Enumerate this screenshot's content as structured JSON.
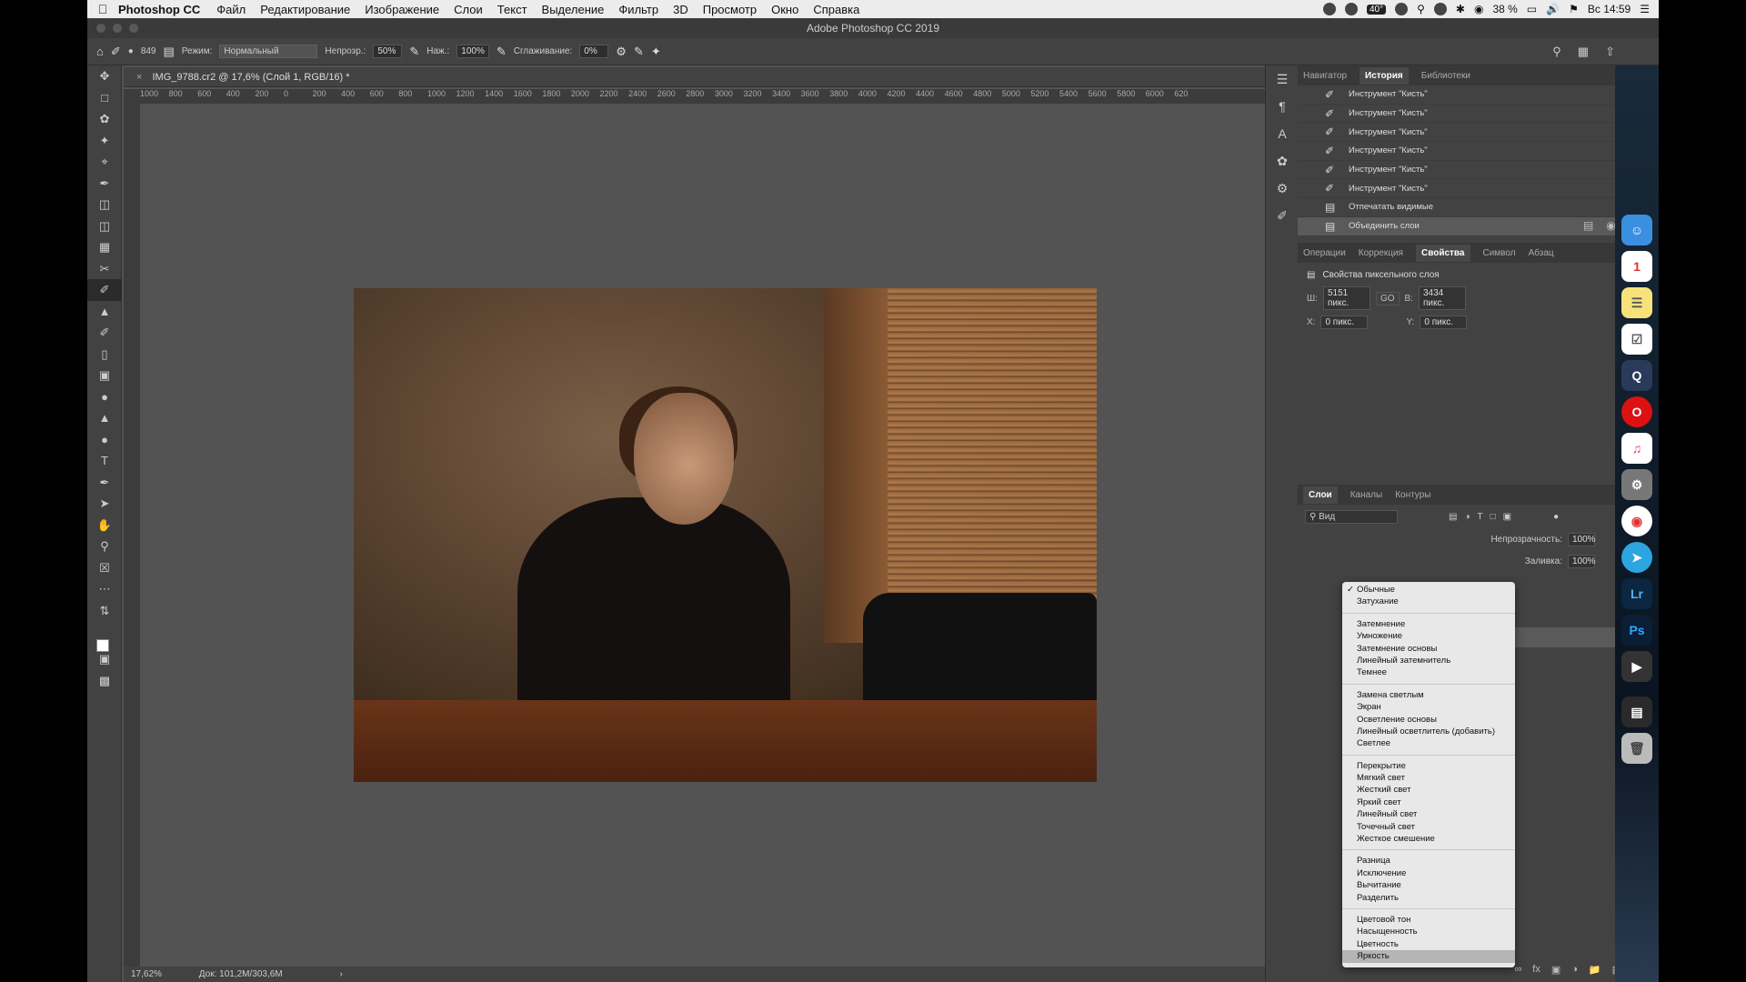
{
  "menubar": {
    "app_name": "Photoshop CC",
    "items": [
      "Файл",
      "Редактирование",
      "Изображение",
      "Слои",
      "Текст",
      "Выделение",
      "Фильтр",
      "3D",
      "Просмотр",
      "Окно",
      "Справка"
    ],
    "battery": "38 %",
    "clock": "Вс 14:59",
    "badge": "40°"
  },
  "window_title": "Adobe Photoshop CC 2019",
  "options_bar": {
    "brush_size": "849",
    "mode_label": "Режим:",
    "mode_value": "Нормальный",
    "opacity_label": "Непрозр.:",
    "opacity_value": "50%",
    "flow_label": "Наж.:",
    "flow_value": "100%",
    "smoothing_label": "Сглаживание:",
    "smoothing_value": "0%"
  },
  "document": {
    "tab_title": "IMG_9788.cr2 @ 17,6% (Слой 1, RGB/16) *",
    "ruler_ticks": [
      "1000",
      "800",
      "600",
      "400",
      "200",
      "0",
      "200",
      "400",
      "600",
      "800",
      "1000",
      "1200",
      "1400",
      "1600",
      "1800",
      "2000",
      "2200",
      "2400",
      "2600",
      "2800",
      "3000",
      "3200",
      "3400",
      "3600",
      "3800",
      "4000",
      "4200",
      "4400",
      "4600",
      "4800",
      "5000",
      "5200",
      "5400",
      "5600",
      "5800",
      "6000",
      "620"
    ],
    "zoom": "17,62%",
    "doc_size": "Док: 101,2M/303,6M"
  },
  "history_panel": {
    "tabs": [
      "Навигатор",
      "История",
      "Библиотеки"
    ],
    "active_tab": "История",
    "entries": [
      {
        "label": "Инструмент \"Кисть\""
      },
      {
        "label": "Инструмент \"Кисть\""
      },
      {
        "label": "Инструмент \"Кисть\""
      },
      {
        "label": "Инструмент \"Кисть\""
      },
      {
        "label": "Инструмент \"Кисть\""
      },
      {
        "label": "Инструмент \"Кисть\""
      },
      {
        "label": "Отпечатать видимые"
      },
      {
        "label": "Объединить слои"
      }
    ]
  },
  "properties_panel": {
    "tabs": [
      "Операции",
      "Коррекция",
      "Свойства",
      "Символ",
      "Абзац"
    ],
    "active_tab": "Свойства",
    "title": "Свойства пиксельного слоя",
    "w_label": "Ш:",
    "w_value": "5151 пикс.",
    "link_label": "GO",
    "h_label": "В:",
    "h_value": "3434 пикс.",
    "x_label": "X:",
    "x_value": "0 пикс.",
    "y_label": "Y:",
    "y_value": "0 пикс."
  },
  "layers_panel": {
    "tabs": [
      "Слои",
      "Каналы",
      "Контуры"
    ],
    "active_tab": "Слои",
    "filter_placeholder": "Вид",
    "opacity_label": "Непрозрачность:",
    "opacity_value": "100%",
    "fill_label": "Заливка:",
    "fill_value": "100%"
  },
  "blend_dropdown": {
    "groups": [
      [
        "Обычные",
        "Затухание"
      ],
      [
        "Затемнение",
        "Умножение",
        "Затемнение основы",
        "Линейный затемнитель",
        "Темнее"
      ],
      [
        "Замена светлым",
        "Экран",
        "Осветление основы",
        "Линейный осветлитель (добавить)",
        "Светлее"
      ],
      [
        "Перекрытие",
        "Мягкий свет",
        "Жесткий свет",
        "Яркий свет",
        "Линейный свет",
        "Точечный свет",
        "Жесткое смешение"
      ],
      [
        "Разница",
        "Исключение",
        "Вычитание",
        "Разделить"
      ],
      [
        "Цветовой тон",
        "Насыщенность",
        "Цветность",
        "Яркость"
      ]
    ],
    "checked": "Обычные",
    "highlighted": "Яркость"
  },
  "dock": {
    "apps": [
      "finder-icon",
      "calendar-icon",
      "notes-icon",
      "reminders-icon",
      "quicktime-icon",
      "opera-icon",
      "itunes-icon",
      "system-preferences-icon",
      "chrome-icon",
      "telegram-icon",
      "lightroom-icon",
      "photoshop-icon",
      "final-cut-icon",
      "downloads-icon",
      "trash-icon"
    ],
    "calendar_day": "1",
    "lightroom_label": "Lr",
    "photoshop_label": "Ps"
  }
}
